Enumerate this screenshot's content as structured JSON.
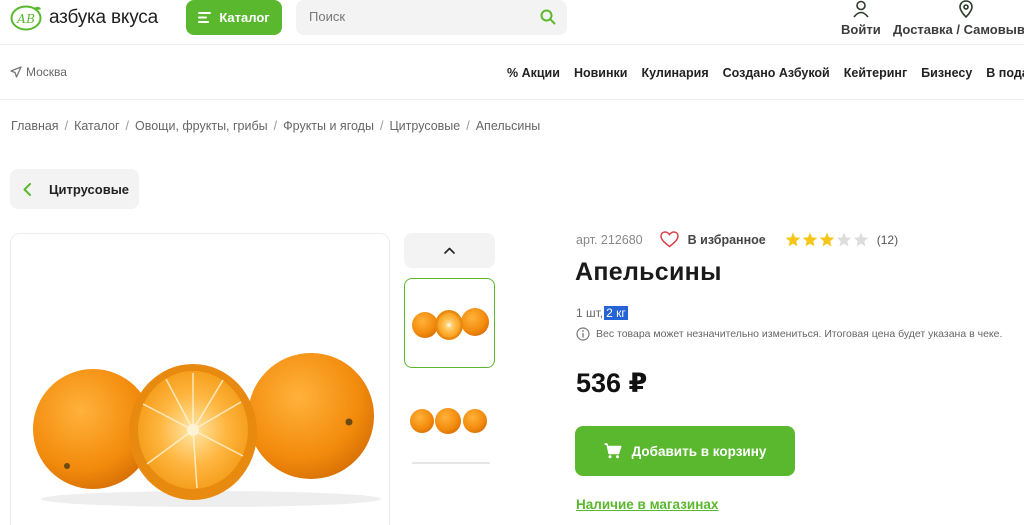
{
  "header": {
    "logo_text": "азбука вкуса",
    "catalog_label": "Каталог",
    "search_placeholder": "Поиск",
    "login_label": "Войти",
    "delivery_label": "Доставка / Самовывоз"
  },
  "nav": {
    "city": "Москва",
    "links": [
      "% Акции",
      "Новинки",
      "Кулинария",
      "Создано Азбукой",
      "Кейтеринг",
      "Бизнесу",
      "В подарок"
    ]
  },
  "breadcrumbs": [
    "Главная",
    "Каталог",
    "Овощи, фрукты, грибы",
    "Фрукты и ягоды",
    "Цитрусовые",
    "Апельсины"
  ],
  "back_label": "Цитрусовые",
  "product": {
    "article": "арт. 212680",
    "favorite_label": "В избранное",
    "rating_value": 3,
    "rating_max": 5,
    "rating_count": "(12)",
    "title": "Апельсины",
    "weight_prefix": "1 шт,",
    "weight_selected": "2 кг",
    "weight_note": "Вес товара может незначительно измениться. Итоговая цена будет указана в чеке.",
    "price": "536 ₽",
    "cart_label": "Добавить в корзину",
    "stores_label": "Наличие в магазинах"
  },
  "colors": {
    "brand_green": "#5ab82f",
    "star_filled": "#f5c518",
    "star_empty": "#dddddd",
    "selection_blue": "#2563d6"
  }
}
